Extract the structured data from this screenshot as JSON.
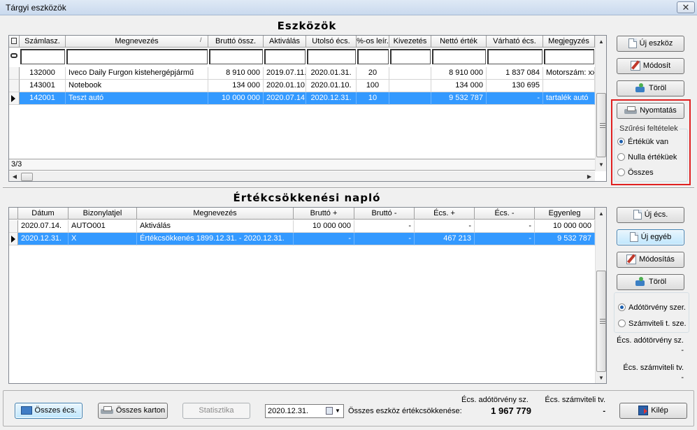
{
  "window": {
    "title": "Tárgyi eszközök",
    "close_glyph": "✕"
  },
  "assets": {
    "title": "Eszközök",
    "columns": [
      "Számlasz.",
      "Megnevezés",
      "Bruttó össz.",
      "Aktiválás",
      "Utolsó écs.",
      "%-os leír.",
      "Kivezetés",
      "Nettó érték",
      "Várható écs.",
      "Megjegyzés"
    ],
    "sort_indicator": "/",
    "rows": [
      [
        "132000",
        "Iveco Daily Furgon kistehergépjármű",
        "8 910 000",
        "2019.07.11.",
        "2020.01.31.",
        "20",
        "",
        "8 910 000",
        "1 837 084",
        "Motorszám: xxx"
      ],
      [
        "143001",
        "Notebook",
        "134 000",
        "2020.01.10.",
        "2020.01.10.",
        "100",
        "",
        "134 000",
        "130 695",
        ""
      ],
      [
        "142001",
        "Teszt autó",
        "10 000 000",
        "2020.07.14.",
        "2020.12.31.",
        "10",
        "",
        "9 532 787",
        "-",
        "tartalék autó"
      ]
    ],
    "selected_row": 2,
    "record_count": "3/3"
  },
  "asset_buttons": {
    "new": "Új eszköz",
    "edit": "Módosít",
    "delete": "Töröl",
    "print": "Nyomtatás"
  },
  "filter": {
    "title": "Szűrési feltételek",
    "options": [
      "Értékük van",
      "Nulla értéküek",
      "Összes"
    ],
    "selected": 0
  },
  "journal": {
    "title": "Értékcsökkenési napló",
    "columns": [
      "Dátum",
      "Bizonylatjel",
      "Megnevezés",
      "Bruttó +",
      "Bruttó -",
      "Écs. +",
      "Écs. -",
      "Egyenleg"
    ],
    "rows": [
      [
        "2020.07.14.",
        "AUTO001",
        "Aktiválás",
        "10 000 000",
        "-",
        "-",
        "-",
        "10 000 000"
      ],
      [
        "2020.12.31.",
        "X",
        "Értékcsökkenés 1899.12.31. - 2020.12.31.",
        "-",
        "-",
        "467 213",
        "-",
        "9 532 787"
      ]
    ],
    "selected_row": 1
  },
  "journal_buttons": {
    "new_ecs": "Új écs.",
    "new_other": "Új egyéb",
    "edit": "Módosítás",
    "delete": "Töröl"
  },
  "law_options": {
    "options": [
      "Adótörvény szer.",
      "Számviteli t. sze."
    ],
    "selected": 0
  },
  "side_summary": {
    "tax_label": "Écs. adótörvény sz.",
    "tax_value": "-",
    "acc_label": "Écs. számviteli tv.",
    "acc_value": "-"
  },
  "footer": {
    "total_ecs": "Összes écs.",
    "total_card": "Összes karton",
    "statistics": "Statisztika",
    "date": "2020.12.31.",
    "total_label": "Összes eszköz értékcsökkenése:",
    "tax_label": "Écs. adótörvény sz.",
    "tax_value": "1 967 779",
    "acc_label": "Écs. számviteli tv.",
    "acc_value": "-",
    "exit": "Kilép"
  },
  "colors": {
    "selection": "#3399ff",
    "highlight_border": "#e02020"
  }
}
